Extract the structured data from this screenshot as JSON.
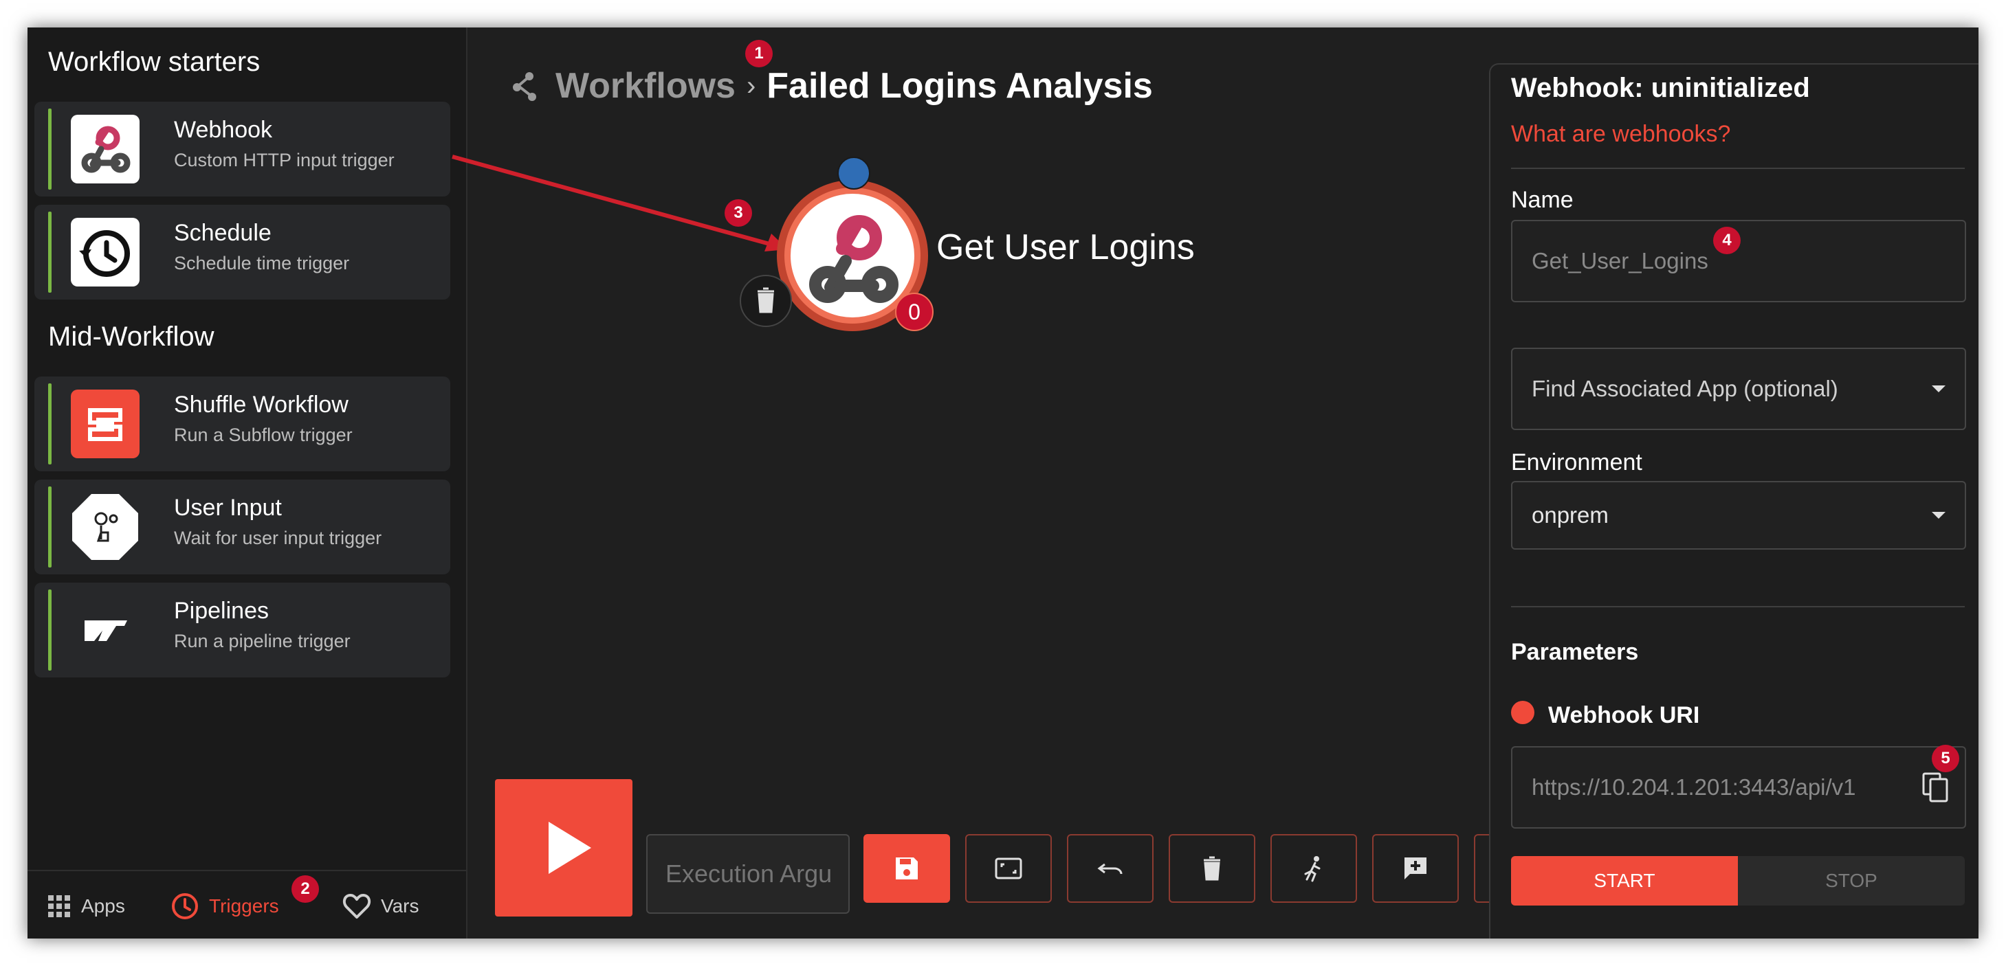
{
  "sidebar": {
    "starters_title": "Workflow starters",
    "mid_title": "Mid-Workflow",
    "starters": [
      {
        "name": "Webhook",
        "desc": "Custom HTTP input trigger",
        "icon": "webhook-icon"
      },
      {
        "name": "Schedule",
        "desc": "Schedule time trigger",
        "icon": "schedule-icon"
      }
    ],
    "mid": [
      {
        "name": "Shuffle Workflow",
        "desc": "Run a Subflow trigger",
        "icon": "shuffle-icon"
      },
      {
        "name": "User Input",
        "desc": "Wait for user input trigger",
        "icon": "user-input-icon"
      },
      {
        "name": "Pipelines",
        "desc": "Run a pipeline trigger",
        "icon": "pipelines-icon"
      }
    ],
    "nav": [
      {
        "label": "Apps",
        "icon": "apps-grid-icon",
        "active": false
      },
      {
        "label": "Triggers",
        "icon": "clock-icon",
        "active": true
      },
      {
        "label": "Vars",
        "icon": "heart-icon",
        "active": false
      }
    ]
  },
  "header": {
    "workflows_label": "Workflows",
    "separator": "›",
    "workflow_name": "Failed Logins Analysis"
  },
  "canvas": {
    "node_label": "Get User Logins",
    "node_count": "0"
  },
  "annotations": {
    "a1": "1",
    "a2": "2",
    "a3": "3",
    "a4": "4",
    "a5": "5"
  },
  "panel": {
    "title": "Webhook: uninitialized",
    "help_link": "What are webhooks?",
    "name_label": "Name",
    "name_value": "Get_User_Logins",
    "app_placeholder": "Find Associated App (optional)",
    "environment_label": "Environment",
    "environment_value": "onprem",
    "parameters_label": "Parameters",
    "webhook_uri_label": "Webhook URI",
    "webhook_uri_value": "https://10.204.1.201:3443/api/v1",
    "start_label": "START",
    "stop_label": "STOP"
  },
  "toolbar": {
    "exec_placeholder": "Execution Argu"
  },
  "colors": {
    "accent": "#f04a3a",
    "badge": "#c8102e",
    "card_bar": "#7bb844",
    "panel_bg": "#1e1e1e",
    "canvas_bg": "#1f1f1f",
    "node_handle": "#2f6db5"
  }
}
